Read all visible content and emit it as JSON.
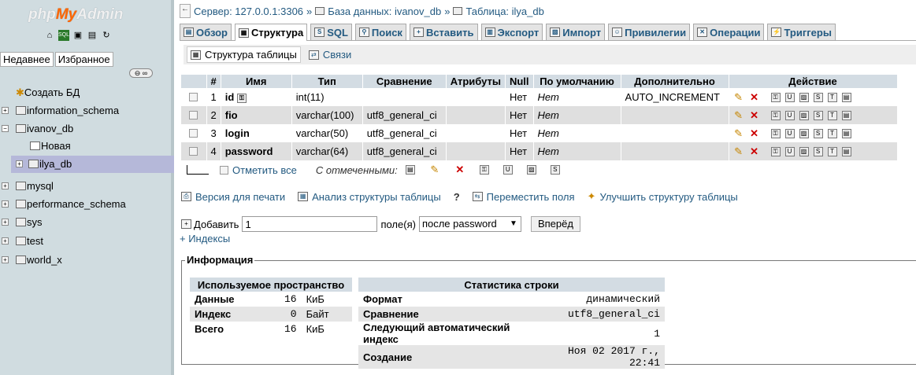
{
  "sidebar": {
    "logo_php": "php",
    "logo_my": "My",
    "logo_admin": "Admin",
    "tab_recent": "Недавнее",
    "tab_favorites": "Избранное",
    "create_db": "Создать БД",
    "databases": [
      {
        "name": "information_schema"
      },
      {
        "name": "ivanov_db"
      },
      {
        "name": "mysql"
      },
      {
        "name": "performance_schema"
      },
      {
        "name": "sys"
      },
      {
        "name": "test"
      },
      {
        "name": "world_x"
      }
    ],
    "new_table": "Новая",
    "selected_table": "ilya_db"
  },
  "breadcrumb": {
    "server": "Сервер: 127.0.0.1:3306",
    "database": "База данных: ivanov_db",
    "table": "Таблица: ilya_db"
  },
  "tabs": [
    {
      "label": "Обзор",
      "icon": "browse-icon"
    },
    {
      "label": "Структура",
      "icon": "structure-icon"
    },
    {
      "label": "SQL",
      "icon": "sql-icon"
    },
    {
      "label": "Поиск",
      "icon": "search-icon"
    },
    {
      "label": "Вставить",
      "icon": "insert-icon"
    },
    {
      "label": "Экспорт",
      "icon": "export-icon"
    },
    {
      "label": "Импорт",
      "icon": "import-icon"
    },
    {
      "label": "Привилегии",
      "icon": "privileges-icon"
    },
    {
      "label": "Операции",
      "icon": "operations-icon"
    },
    {
      "label": "Триггеры",
      "icon": "triggers-icon"
    }
  ],
  "subtabs": {
    "structure": "Структура таблицы",
    "relations": "Связи"
  },
  "table": {
    "headers": [
      "#",
      "Имя",
      "Тип",
      "Сравнение",
      "Атрибуты",
      "Null",
      "По умолчанию",
      "Дополнительно",
      "Действие"
    ],
    "rows": [
      {
        "num": "1",
        "name": "id",
        "type": "int(11)",
        "collation": "",
        "attributes": "",
        "null": "Нет",
        "default": "Нет",
        "extra": "AUTO_INCREMENT"
      },
      {
        "num": "2",
        "name": "fio",
        "type": "varchar(100)",
        "collation": "utf8_general_ci",
        "attributes": "",
        "null": "Нет",
        "default": "Нет",
        "extra": ""
      },
      {
        "num": "3",
        "name": "login",
        "type": "varchar(50)",
        "collation": "utf8_general_ci",
        "attributes": "",
        "null": "Нет",
        "default": "Нет",
        "extra": ""
      },
      {
        "num": "4",
        "name": "password",
        "type": "varchar(64)",
        "collation": "utf8_general_ci",
        "attributes": "",
        "null": "Нет",
        "default": "Нет",
        "extra": ""
      }
    ]
  },
  "bulk": {
    "check_all": "Отметить все",
    "with_selected": "С отмеченными:"
  },
  "links": {
    "print": "Версия для печати",
    "analyze": "Анализ структуры таблицы",
    "move": "Переместить поля",
    "improve": "Улучшить структуру таблицы"
  },
  "add": {
    "label": "Добавить",
    "value": "1",
    "fields": "поле(я)",
    "position": "после password",
    "go": "Вперёд",
    "indexes": "+ Индексы"
  },
  "info": {
    "legend": "Информация",
    "space_header": "Используемое пространство",
    "space": [
      {
        "label": "Данные",
        "value": "16",
        "unit": "КиБ"
      },
      {
        "label": "Индекс",
        "value": "0",
        "unit": "Байт"
      },
      {
        "label": "Всего",
        "value": "16",
        "unit": "КиБ"
      }
    ],
    "stats_header": "Статистика строки",
    "stats": [
      {
        "label": "Формат",
        "value": "динамический"
      },
      {
        "label": "Сравнение",
        "value": "utf8_general_ci"
      },
      {
        "label": "Следующий автоматический индекс",
        "value": "1"
      },
      {
        "label": "Создание",
        "value": "Ноя 02 2017 г., 22:41"
      }
    ]
  }
}
